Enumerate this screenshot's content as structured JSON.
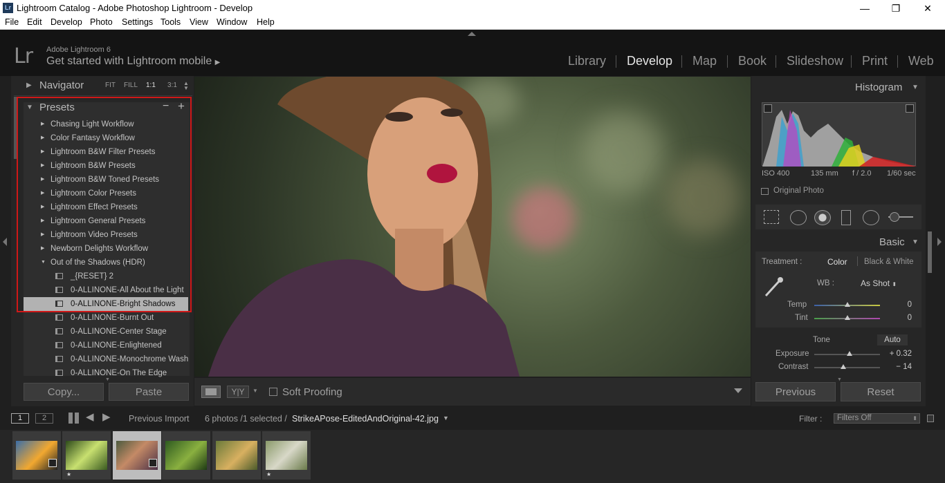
{
  "window": {
    "title": "Lightroom Catalog - Adobe Photoshop Lightroom - Develop",
    "app_icon": "Lr",
    "minimize": "—",
    "maximize": "❐",
    "close": "✕"
  },
  "menu": [
    "File",
    "Edit",
    "Develop",
    "Photo",
    "Settings",
    "Tools",
    "View",
    "Window",
    "Help"
  ],
  "identity": {
    "logo": "Lr",
    "sub": "Adobe Lightroom 6",
    "mobile": "Get started with Lightroom mobile"
  },
  "modules": [
    "Library",
    "Develop",
    "Map",
    "Book",
    "Slideshow",
    "Print",
    "Web"
  ],
  "navigator": {
    "title": "Navigator",
    "zoom": [
      "FIT",
      "FILL",
      "1:1",
      "3:1"
    ]
  },
  "presets": {
    "title": "Presets",
    "minus": "−",
    "plus": "+",
    "folders": [
      "Chasing Light Workflow",
      "Color Fantasy Workflow",
      "Lightroom B&W Filter Presets",
      "Lightroom B&W Presets",
      "Lightroom B&W Toned Presets",
      "Lightroom Color Presets",
      "Lightroom Effect Presets",
      "Lightroom General Presets",
      "Lightroom Video Presets",
      "Newborn Delights Workflow",
      "Out of the Shadows (HDR)"
    ],
    "items": [
      "_{RESET} 2",
      "0-ALLINONE-All About the Light",
      "0-ALLINONE-Bright Shadows",
      "0-ALLINONE-Burnt Out",
      "0-ALLINONE-Center Stage",
      "0-ALLINONE-Enlightened",
      "0-ALLINONE-Monochrome Wash",
      "0-ALLINONE-On The Edge"
    ],
    "selected_index": 2
  },
  "left_buttons": {
    "copy": "Copy...",
    "paste": "Paste"
  },
  "toolbar": {
    "view_yy": "Y|Y",
    "soft_proofing": "Soft Proofing"
  },
  "histogram": {
    "title": "Histogram",
    "iso": "ISO 400",
    "focal": "135 mm",
    "aperture": "f / 2.0",
    "shutter": "1/60 sec",
    "original_photo": "Original Photo"
  },
  "basic": {
    "title": "Basic",
    "treatment_label": "Treatment :",
    "color": "Color",
    "bw": "Black & White",
    "wb_label": "WB :",
    "wb_value": "As Shot",
    "temp_label": "Temp",
    "temp_value": "0",
    "tint_label": "Tint",
    "tint_value": "0",
    "tone_label": "Tone",
    "auto": "Auto",
    "exposure_label": "Exposure",
    "exposure_value": "+ 0.32",
    "contrast_label": "Contrast",
    "contrast_value": "− 14"
  },
  "right_buttons": {
    "previous": "Previous",
    "reset": "Reset"
  },
  "filmbar": {
    "screen1": "1",
    "screen2": "2",
    "source": "Previous Import",
    "count": "6 photos /1 selected /",
    "filename": "StrikeAPose-EditedAndOriginal-42.jpg",
    "filter_label": "Filter :",
    "filter_value": "Filters Off"
  },
  "colors": {
    "accent_red": "#d01818",
    "panel_bg": "#262626",
    "selected_row": "#b2b2b2"
  }
}
